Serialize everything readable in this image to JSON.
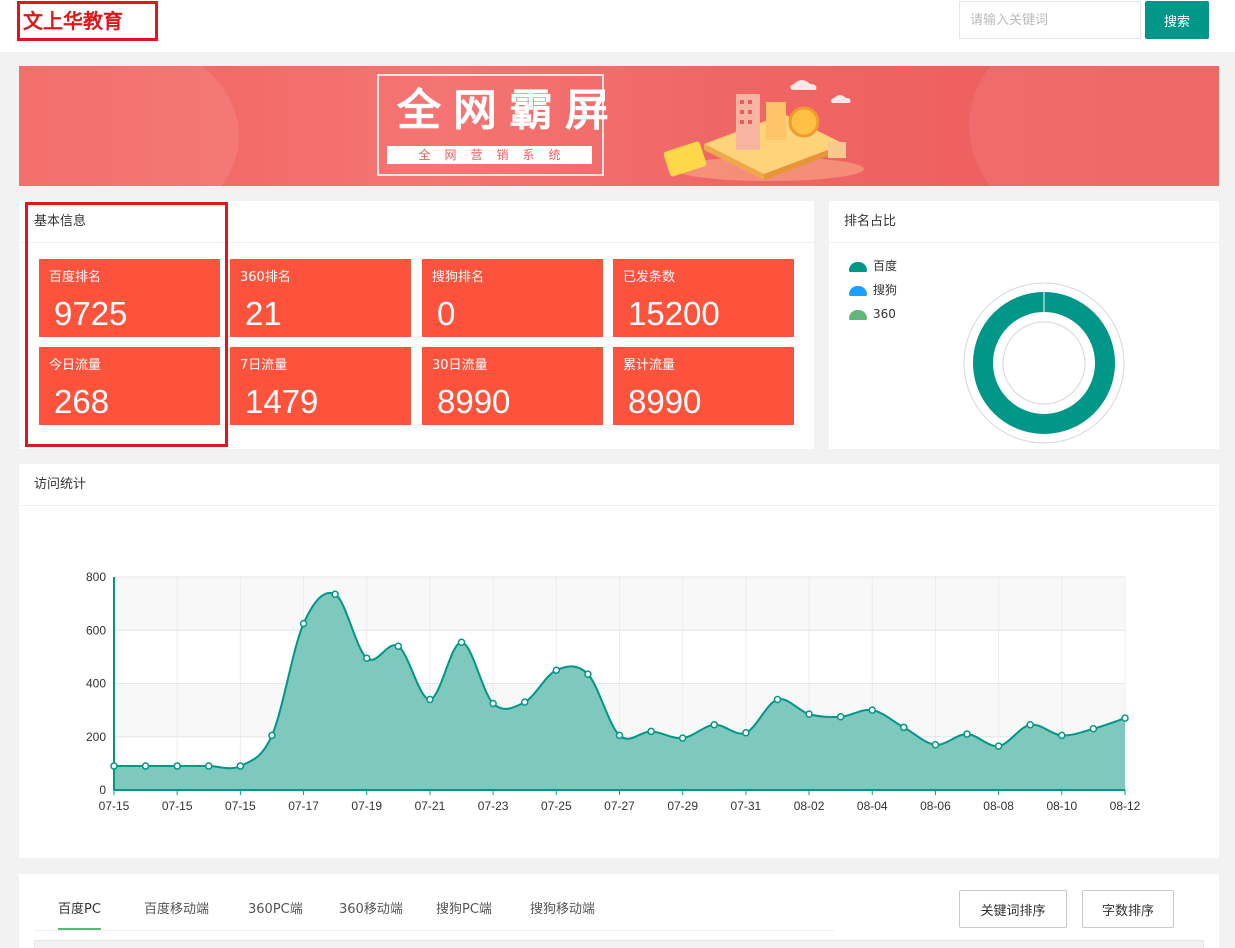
{
  "header": {
    "logo_text": "文上华教育",
    "search_placeholder": "请输入关键词",
    "search_button": "搜索"
  },
  "banner": {
    "title": "全网霸屏",
    "subtitle": "全网营销系统"
  },
  "basic_info": {
    "title": "基本信息",
    "tiles": [
      {
        "label": "百度排名",
        "value": "9725"
      },
      {
        "label": "360排名",
        "value": "21"
      },
      {
        "label": "搜狗排名",
        "value": "0"
      },
      {
        "label": "已发条数",
        "value": "15200"
      },
      {
        "label": "今日流量",
        "value": "268"
      },
      {
        "label": "7日流量",
        "value": "1479"
      },
      {
        "label": "30日流量",
        "value": "8990"
      },
      {
        "label": "累计流量",
        "value": "8990"
      }
    ]
  },
  "ranking_share": {
    "title": "排名占比",
    "legend": [
      {
        "name": "百度",
        "color": "#009688"
      },
      {
        "name": "搜狗",
        "color": "#1e9fff"
      },
      {
        "name": "360",
        "color": "#5fb878"
      }
    ]
  },
  "visit_stats": {
    "title": "访问统计"
  },
  "chart_data": {
    "type": "area",
    "x": [
      "07-15",
      "07-15",
      "07-15",
      "07-15",
      "07-15",
      "07-16",
      "07-17",
      "07-18",
      "07-19",
      "07-20",
      "07-21",
      "07-22",
      "07-23",
      "07-24",
      "07-25",
      "07-26",
      "07-27",
      "07-28",
      "07-29",
      "07-30",
      "07-31",
      "08-01",
      "08-02",
      "08-03",
      "08-04",
      "08-05",
      "08-06",
      "08-07",
      "08-08",
      "08-09",
      "08-10",
      "08-11",
      "08-12"
    ],
    "xtick_labels": [
      "07-15",
      "07-15",
      "07-15",
      "07-17",
      "07-19",
      "07-21",
      "07-23",
      "07-25",
      "07-27",
      "07-29",
      "07-31",
      "08-02",
      "08-04",
      "08-06",
      "08-08",
      "08-10",
      "08-12"
    ],
    "values": [
      90,
      90,
      90,
      90,
      90,
      205,
      625,
      735,
      495,
      540,
      340,
      555,
      325,
      330,
      450,
      435,
      205,
      220,
      195,
      245,
      215,
      340,
      285,
      275,
      300,
      235,
      170,
      210,
      165,
      245,
      205,
      230,
      270
    ],
    "yticks": [
      0,
      200,
      400,
      600,
      800
    ],
    "ylim": [
      0,
      800
    ],
    "color": "#009688",
    "fill": "#7ec8be",
    "grid": true
  },
  "bottom": {
    "tabs": [
      "百度PC",
      "百度移动端",
      "360PC端",
      "360移动端",
      "搜狗PC端",
      "搜狗移动端"
    ],
    "sort_keyword": "关键词排序",
    "sort_length": "字数排序"
  }
}
